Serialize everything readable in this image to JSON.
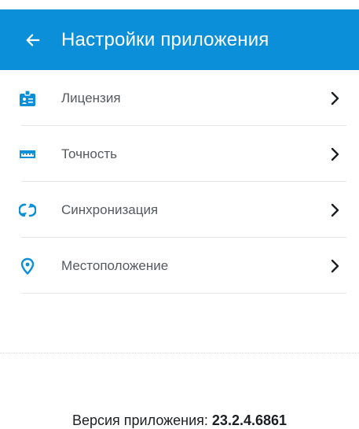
{
  "header": {
    "title": "Настройки приложения",
    "background_color": "#0a8fd8",
    "back_icon": "arrow-left-icon"
  },
  "menu": {
    "icon_color": "#0a8fd8",
    "items": [
      {
        "label": "Лицензия",
        "icon": "license-badge-icon"
      },
      {
        "label": "Точность",
        "icon": "ruler-icon"
      },
      {
        "label": "Синхронизация",
        "icon": "sync-icon"
      },
      {
        "label": "Местоположение",
        "icon": "location-pin-icon"
      }
    ]
  },
  "footer": {
    "version_label": "Версия приложения: ",
    "version_number": "23.2.4.6861"
  }
}
